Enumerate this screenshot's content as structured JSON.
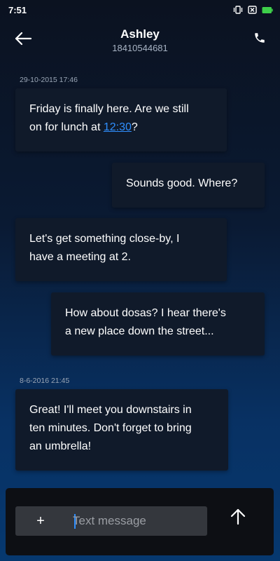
{
  "status_bar": {
    "time": "7:51",
    "icons": [
      "vibrate-icon",
      "no-sim-icon",
      "battery-icon"
    ],
    "battery_color": "#3ecf4a"
  },
  "header": {
    "contact_name": "Ashley",
    "contact_number": "18410544681",
    "icons": [
      "back-arrow-icon",
      "phone-icon"
    ]
  },
  "conversation": {
    "timestamps": [
      "29-10-2015 17:46",
      "8-6-2016 21:45"
    ],
    "messages": [
      {
        "direction": "incoming",
        "line1": "Friday is finally here. Are we still",
        "line2_prefix": "on for lunch at ",
        "line2_link": "12:30",
        "line2_suffix": "?"
      },
      {
        "direction": "outgoing",
        "text": "Sounds good. Where?"
      },
      {
        "direction": "incoming",
        "line1": "Let's get something close-by, I",
        "line2": "have a meeting at 2."
      },
      {
        "direction": "outgoing",
        "line1": "How about dosas? I hear there's",
        "line2": "a new place down the street..."
      },
      {
        "direction": "incoming",
        "line1": "Great! I'll meet you downstairs in",
        "line2": "ten minutes. Don't forget to bring",
        "line3": "an umbrella!"
      }
    ],
    "link_color": "#2f8fff"
  },
  "composer": {
    "plus_label": "+",
    "placeholder": "Text message",
    "value": "",
    "icons": [
      "plus-icon",
      "send-arrow-icon"
    ]
  }
}
